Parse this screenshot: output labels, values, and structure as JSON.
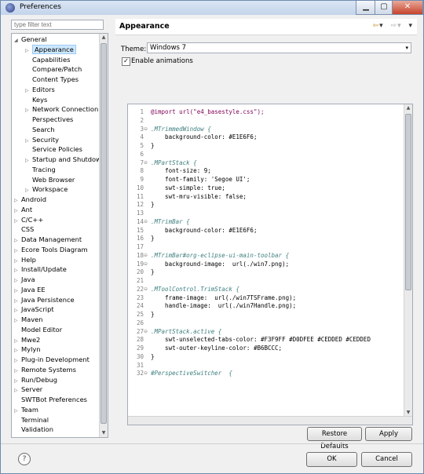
{
  "window": {
    "title": "Preferences",
    "min": "▁",
    "max": "▢",
    "close": "✕"
  },
  "filter": {
    "placeholder": "type filter text"
  },
  "tree": {
    "items": [
      {
        "label": "General",
        "level": 0,
        "expander": "open"
      },
      {
        "label": "Appearance",
        "level": 1,
        "expander": "closed",
        "selected": true
      },
      {
        "label": "Capabilities",
        "level": 1,
        "expander": "none"
      },
      {
        "label": "Compare/Patch",
        "level": 1,
        "expander": "none"
      },
      {
        "label": "Content Types",
        "level": 1,
        "expander": "none"
      },
      {
        "label": "Editors",
        "level": 1,
        "expander": "closed"
      },
      {
        "label": "Keys",
        "level": 1,
        "expander": "none"
      },
      {
        "label": "Network Connection",
        "level": 1,
        "expander": "closed"
      },
      {
        "label": "Perspectives",
        "level": 1,
        "expander": "none"
      },
      {
        "label": "Search",
        "level": 1,
        "expander": "none"
      },
      {
        "label": "Security",
        "level": 1,
        "expander": "closed"
      },
      {
        "label": "Service Policies",
        "level": 1,
        "expander": "none"
      },
      {
        "label": "Startup and Shutdow",
        "level": 1,
        "expander": "closed"
      },
      {
        "label": "Tracing",
        "level": 1,
        "expander": "none"
      },
      {
        "label": "Web Browser",
        "level": 1,
        "expander": "none"
      },
      {
        "label": "Workspace",
        "level": 1,
        "expander": "closed"
      },
      {
        "label": "Android",
        "level": 0,
        "expander": "closed"
      },
      {
        "label": "Ant",
        "level": 0,
        "expander": "closed"
      },
      {
        "label": "C/C++",
        "level": 0,
        "expander": "closed"
      },
      {
        "label": "CSS",
        "level": 0,
        "expander": "none"
      },
      {
        "label": "Data Management",
        "level": 0,
        "expander": "closed"
      },
      {
        "label": "Ecore Tools Diagram",
        "level": 0,
        "expander": "closed"
      },
      {
        "label": "Help",
        "level": 0,
        "expander": "closed"
      },
      {
        "label": "Install/Update",
        "level": 0,
        "expander": "closed"
      },
      {
        "label": "Java",
        "level": 0,
        "expander": "closed"
      },
      {
        "label": "Java EE",
        "level": 0,
        "expander": "closed"
      },
      {
        "label": "Java Persistence",
        "level": 0,
        "expander": "closed"
      },
      {
        "label": "JavaScript",
        "level": 0,
        "expander": "closed"
      },
      {
        "label": "Maven",
        "level": 0,
        "expander": "closed"
      },
      {
        "label": "Model Editor",
        "level": 0,
        "expander": "none"
      },
      {
        "label": "Mwe2",
        "level": 0,
        "expander": "closed"
      },
      {
        "label": "Mylyn",
        "level": 0,
        "expander": "closed"
      },
      {
        "label": "Plug-in Development",
        "level": 0,
        "expander": "closed"
      },
      {
        "label": "Remote Systems",
        "level": 0,
        "expander": "closed"
      },
      {
        "label": "Run/Debug",
        "level": 0,
        "expander": "closed"
      },
      {
        "label": "Server",
        "level": 0,
        "expander": "closed"
      },
      {
        "label": "SWTBot Preferences",
        "level": 0,
        "expander": "none"
      },
      {
        "label": "Team",
        "level": 0,
        "expander": "closed"
      },
      {
        "label": "Terminal",
        "level": 0,
        "expander": "none"
      },
      {
        "label": "Validation",
        "level": 0,
        "expander": "none"
      }
    ]
  },
  "page": {
    "title": "Appearance",
    "nav": {
      "back": "⇦",
      "back_menu": "▾",
      "forward": "⇨",
      "forward_menu": "▾",
      "menu": "▾"
    },
    "theme_label": "Theme:",
    "theme_value": "Windows 7",
    "theme_dropdown": "▾",
    "animations_label": "Enable animations",
    "animations_checked": true,
    "animations_mark": "✓"
  },
  "editor": {
    "lines": [
      {
        "n": "1",
        "fold": "",
        "text": "@import url(\"e4_basestyle.css\");"
      },
      {
        "n": "2",
        "fold": "",
        "text": ""
      },
      {
        "n": "3",
        "fold": "⊖",
        "text": ".MTrimmedWindow {"
      },
      {
        "n": "4",
        "fold": "",
        "text": "    background-color: #E1E6F6;"
      },
      {
        "n": "5",
        "fold": "",
        "text": "}"
      },
      {
        "n": "6",
        "fold": "",
        "text": ""
      },
      {
        "n": "7",
        "fold": "⊖",
        "text": ".MPartStack {"
      },
      {
        "n": "8",
        "fold": "",
        "text": "    font-size: 9;"
      },
      {
        "n": "9",
        "fold": "",
        "text": "    font-family: 'Segoe UI';"
      },
      {
        "n": "10",
        "fold": "",
        "text": "    swt-simple: true;"
      },
      {
        "n": "11",
        "fold": "",
        "text": "    swt-mru-visible: false;"
      },
      {
        "n": "12",
        "fold": "",
        "text": "}"
      },
      {
        "n": "13",
        "fold": "",
        "text": ""
      },
      {
        "n": "14",
        "fold": "⊖",
        "text": ".MTrimBar {"
      },
      {
        "n": "15",
        "fold": "",
        "text": "    background-color: #E1E6F6;"
      },
      {
        "n": "16",
        "fold": "",
        "text": "}"
      },
      {
        "n": "17",
        "fold": "",
        "text": ""
      },
      {
        "n": "18",
        "fold": "⊖",
        "text": ".MTrimBar#org-eclipse-ui-main-toolbar {"
      },
      {
        "n": "19",
        "fold": "⊖",
        "text": "    background-image:  url(./win7.png);"
      },
      {
        "n": "20",
        "fold": "",
        "text": "}"
      },
      {
        "n": "21",
        "fold": "",
        "text": ""
      },
      {
        "n": "22",
        "fold": "⊖",
        "text": ".MToolControl.TrimStack {"
      },
      {
        "n": "23",
        "fold": "",
        "text": "    frame-image:  url(./win7TSFrame.png);"
      },
      {
        "n": "24",
        "fold": "",
        "text": "    handle-image:  url(./win7Handle.png);"
      },
      {
        "n": "25",
        "fold": "",
        "text": "}"
      },
      {
        "n": "26",
        "fold": "",
        "text": ""
      },
      {
        "n": "27",
        "fold": "⊖",
        "text": ".MPartStack.active {"
      },
      {
        "n": "28",
        "fold": "",
        "text": "    swt-unselected-tabs-color: #F3F9FF #D0DFEE #CEDDED #CEDDED"
      },
      {
        "n": "29",
        "fold": "",
        "text": "    swt-outer-keyline-color: #B6BCCC;"
      },
      {
        "n": "30",
        "fold": "",
        "text": "}"
      },
      {
        "n": "31",
        "fold": "",
        "text": ""
      },
      {
        "n": "32",
        "fold": "⊖",
        "text": "#PerspectiveSwitcher  {"
      }
    ]
  },
  "buttons": {
    "restore_defaults": "Restore Defaults",
    "apply": "Apply",
    "ok": "OK",
    "cancel": "Cancel",
    "help": "?"
  },
  "colors": {
    "selection": "#cde8ff",
    "keyword": "#7f0055",
    "string": "#2a00ff",
    "selector": "#3f7f7f"
  }
}
